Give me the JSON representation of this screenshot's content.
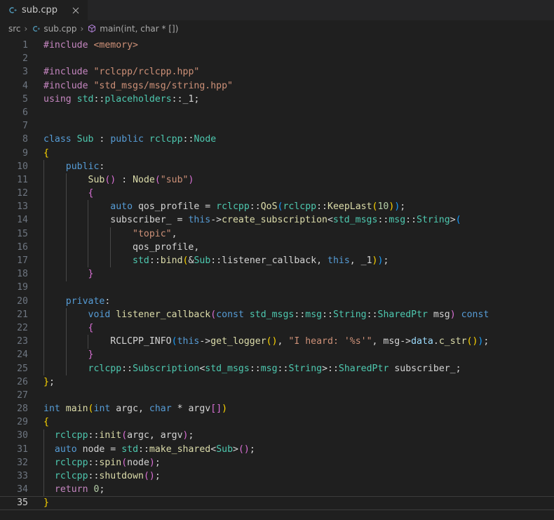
{
  "window": {
    "background": "#1f1f1f",
    "tabbar_background": "#252526"
  },
  "tab_bar": {
    "tabs": [
      {
        "label": "sub.cpp",
        "icon": "cpp-file-icon",
        "icon_color": "#519aba",
        "active": true,
        "close_icon": "close-icon"
      }
    ]
  },
  "breadcrumb": {
    "items": [
      {
        "label": "src",
        "icon": null
      },
      {
        "label": "sub.cpp",
        "icon": "cpp-file-icon"
      },
      {
        "label": "main(int, char * [])",
        "icon": "symbol-method-icon"
      }
    ],
    "separator": "›"
  },
  "editor": {
    "language": "cpp",
    "active_line": 35,
    "total_lines": 35,
    "line_numbers": [
      1,
      2,
      3,
      4,
      5,
      6,
      7,
      8,
      9,
      10,
      11,
      12,
      13,
      14,
      15,
      16,
      17,
      18,
      19,
      20,
      21,
      22,
      23,
      24,
      25,
      26,
      27,
      28,
      29,
      30,
      31,
      32,
      33,
      34,
      35
    ],
    "lines": [
      {
        "n": 1,
        "indent": 0,
        "tokens": [
          {
            "t": "#include ",
            "c": "t-pre"
          },
          {
            "t": "<memory>",
            "c": "t-str"
          }
        ]
      },
      {
        "n": 2,
        "indent": 0,
        "tokens": []
      },
      {
        "n": 3,
        "indent": 0,
        "tokens": [
          {
            "t": "#include ",
            "c": "t-pre"
          },
          {
            "t": "\"rclcpp/rclcpp.hpp\"",
            "c": "t-str"
          }
        ]
      },
      {
        "n": 4,
        "indent": 0,
        "tokens": [
          {
            "t": "#include ",
            "c": "t-pre"
          },
          {
            "t": "\"std_msgs/msg/string.hpp\"",
            "c": "t-str"
          }
        ]
      },
      {
        "n": 5,
        "indent": 0,
        "tokens": [
          {
            "t": "using",
            "c": "t-pre"
          },
          {
            "t": " ",
            "c": "t-plain"
          },
          {
            "t": "std",
            "c": "t-type"
          },
          {
            "t": "::",
            "c": "t-plain"
          },
          {
            "t": "placeholders",
            "c": "t-type"
          },
          {
            "t": "::",
            "c": "t-plain"
          },
          {
            "t": "_1",
            "c": "t-plain"
          },
          {
            "t": ";",
            "c": "t-plain"
          }
        ]
      },
      {
        "n": 6,
        "indent": 0,
        "tokens": []
      },
      {
        "n": 7,
        "indent": 0,
        "tokens": []
      },
      {
        "n": 8,
        "indent": 0,
        "tokens": [
          {
            "t": "class",
            "c": "t-key"
          },
          {
            "t": " ",
            "c": "t-plain"
          },
          {
            "t": "Sub",
            "c": "t-type"
          },
          {
            "t": " : ",
            "c": "t-plain"
          },
          {
            "t": "public",
            "c": "t-key"
          },
          {
            "t": " ",
            "c": "t-plain"
          },
          {
            "t": "rclcpp",
            "c": "t-type"
          },
          {
            "t": "::",
            "c": "t-plain"
          },
          {
            "t": "Node",
            "c": "t-type"
          }
        ]
      },
      {
        "n": 9,
        "indent": 0,
        "tokens": [
          {
            "t": "{",
            "c": "t-b1"
          }
        ]
      },
      {
        "n": 10,
        "indent": 1,
        "tokens": [
          {
            "t": "    ",
            "c": "t-plain"
          },
          {
            "t": "public",
            "c": "t-key"
          },
          {
            "t": ":",
            "c": "t-plain"
          }
        ]
      },
      {
        "n": 11,
        "indent": 2,
        "tokens": [
          {
            "t": "        ",
            "c": "t-plain"
          },
          {
            "t": "Sub",
            "c": "t-fn"
          },
          {
            "t": "()",
            "c": "t-b2"
          },
          {
            "t": " : ",
            "c": "t-plain"
          },
          {
            "t": "Node",
            "c": "t-fn"
          },
          {
            "t": "(",
            "c": "t-b2"
          },
          {
            "t": "\"sub\"",
            "c": "t-str"
          },
          {
            "t": ")",
            "c": "t-b2"
          }
        ]
      },
      {
        "n": 12,
        "indent": 2,
        "tokens": [
          {
            "t": "        ",
            "c": "t-plain"
          },
          {
            "t": "{",
            "c": "t-b2"
          }
        ]
      },
      {
        "n": 13,
        "indent": 3,
        "tokens": [
          {
            "t": "            ",
            "c": "t-plain"
          },
          {
            "t": "auto",
            "c": "t-key"
          },
          {
            "t": " qos_profile ",
            "c": "t-plain"
          },
          {
            "t": "= ",
            "c": "t-plain"
          },
          {
            "t": "rclcpp",
            "c": "t-type"
          },
          {
            "t": "::",
            "c": "t-plain"
          },
          {
            "t": "QoS",
            "c": "t-fn"
          },
          {
            "t": "(",
            "c": "t-b3"
          },
          {
            "t": "rclcpp",
            "c": "t-type"
          },
          {
            "t": "::",
            "c": "t-plain"
          },
          {
            "t": "KeepLast",
            "c": "t-fn"
          },
          {
            "t": "(",
            "c": "t-b1"
          },
          {
            "t": "10",
            "c": "t-num"
          },
          {
            "t": ")",
            "c": "t-b1"
          },
          {
            "t": ")",
            "c": "t-b3"
          },
          {
            "t": ";",
            "c": "t-plain"
          }
        ]
      },
      {
        "n": 14,
        "indent": 3,
        "tokens": [
          {
            "t": "            subscriber_ = ",
            "c": "t-plain"
          },
          {
            "t": "this",
            "c": "t-key"
          },
          {
            "t": "->",
            "c": "t-plain"
          },
          {
            "t": "create_subscription",
            "c": "t-fn"
          },
          {
            "t": "<",
            "c": "t-plain"
          },
          {
            "t": "std_msgs",
            "c": "t-type"
          },
          {
            "t": "::",
            "c": "t-plain"
          },
          {
            "t": "msg",
            "c": "t-type"
          },
          {
            "t": "::",
            "c": "t-plain"
          },
          {
            "t": "String",
            "c": "t-type"
          },
          {
            "t": ">",
            "c": "t-plain"
          },
          {
            "t": "(",
            "c": "t-b3"
          }
        ]
      },
      {
        "n": 15,
        "indent": 4,
        "tokens": [
          {
            "t": "                ",
            "c": "t-plain"
          },
          {
            "t": "\"topic\"",
            "c": "t-str"
          },
          {
            "t": ",",
            "c": "t-plain"
          }
        ]
      },
      {
        "n": 16,
        "indent": 4,
        "tokens": [
          {
            "t": "                qos_profile,",
            "c": "t-plain"
          }
        ]
      },
      {
        "n": 17,
        "indent": 4,
        "tokens": [
          {
            "t": "                ",
            "c": "t-plain"
          },
          {
            "t": "std",
            "c": "t-type"
          },
          {
            "t": "::",
            "c": "t-plain"
          },
          {
            "t": "bind",
            "c": "t-fn"
          },
          {
            "t": "(",
            "c": "t-b1"
          },
          {
            "t": "&",
            "c": "t-plain"
          },
          {
            "t": "Sub",
            "c": "t-type"
          },
          {
            "t": "::",
            "c": "t-plain"
          },
          {
            "t": "listener_callback, ",
            "c": "t-plain"
          },
          {
            "t": "this",
            "c": "t-key"
          },
          {
            "t": ", _1",
            "c": "t-plain"
          },
          {
            "t": ")",
            "c": "t-b1"
          },
          {
            "t": ")",
            "c": "t-b3"
          },
          {
            "t": ";",
            "c": "t-plain"
          }
        ]
      },
      {
        "n": 18,
        "indent": 2,
        "tokens": [
          {
            "t": "        ",
            "c": "t-plain"
          },
          {
            "t": "}",
            "c": "t-b2"
          }
        ]
      },
      {
        "n": 19,
        "indent": 0,
        "tokens": []
      },
      {
        "n": 20,
        "indent": 1,
        "tokens": [
          {
            "t": "    ",
            "c": "t-plain"
          },
          {
            "t": "private",
            "c": "t-key"
          },
          {
            "t": ":",
            "c": "t-plain"
          }
        ]
      },
      {
        "n": 21,
        "indent": 2,
        "tokens": [
          {
            "t": "        ",
            "c": "t-plain"
          },
          {
            "t": "void",
            "c": "t-key"
          },
          {
            "t": " ",
            "c": "t-plain"
          },
          {
            "t": "listener_callback",
            "c": "t-fn"
          },
          {
            "t": "(",
            "c": "t-b2"
          },
          {
            "t": "const",
            "c": "t-key"
          },
          {
            "t": " ",
            "c": "t-plain"
          },
          {
            "t": "std_msgs",
            "c": "t-type"
          },
          {
            "t": "::",
            "c": "t-plain"
          },
          {
            "t": "msg",
            "c": "t-type"
          },
          {
            "t": "::",
            "c": "t-plain"
          },
          {
            "t": "String",
            "c": "t-type"
          },
          {
            "t": "::",
            "c": "t-plain"
          },
          {
            "t": "SharedPtr",
            "c": "t-type"
          },
          {
            "t": " msg",
            "c": "t-plain"
          },
          {
            "t": ")",
            "c": "t-b2"
          },
          {
            "t": " ",
            "c": "t-plain"
          },
          {
            "t": "const",
            "c": "t-key"
          }
        ]
      },
      {
        "n": 22,
        "indent": 2,
        "tokens": [
          {
            "t": "        ",
            "c": "t-plain"
          },
          {
            "t": "{",
            "c": "t-b2"
          }
        ]
      },
      {
        "n": 23,
        "indent": 3,
        "tokens": [
          {
            "t": "            RCLCPP_INFO",
            "c": "t-plain"
          },
          {
            "t": "(",
            "c": "t-b3"
          },
          {
            "t": "this",
            "c": "t-key"
          },
          {
            "t": "->",
            "c": "t-plain"
          },
          {
            "t": "get_logger",
            "c": "t-fn"
          },
          {
            "t": "()",
            "c": "t-b1"
          },
          {
            "t": ", ",
            "c": "t-plain"
          },
          {
            "t": "\"I heard: '%s'\"",
            "c": "t-str"
          },
          {
            "t": ", msg",
            "c": "t-plain"
          },
          {
            "t": "->",
            "c": "t-plain"
          },
          {
            "t": "data",
            "c": "t-var"
          },
          {
            "t": ".",
            "c": "t-plain"
          },
          {
            "t": "c_str",
            "c": "t-fn"
          },
          {
            "t": "()",
            "c": "t-b1"
          },
          {
            "t": ")",
            "c": "t-b3"
          },
          {
            "t": ";",
            "c": "t-plain"
          }
        ]
      },
      {
        "n": 24,
        "indent": 2,
        "tokens": [
          {
            "t": "        ",
            "c": "t-plain"
          },
          {
            "t": "}",
            "c": "t-b2"
          }
        ]
      },
      {
        "n": 25,
        "indent": 2,
        "tokens": [
          {
            "t": "        ",
            "c": "t-plain"
          },
          {
            "t": "rclcpp",
            "c": "t-type"
          },
          {
            "t": "::",
            "c": "t-plain"
          },
          {
            "t": "Subscription",
            "c": "t-type"
          },
          {
            "t": "<",
            "c": "t-plain"
          },
          {
            "t": "std_msgs",
            "c": "t-type"
          },
          {
            "t": "::",
            "c": "t-plain"
          },
          {
            "t": "msg",
            "c": "t-type"
          },
          {
            "t": "::",
            "c": "t-plain"
          },
          {
            "t": "String",
            "c": "t-type"
          },
          {
            "t": ">",
            "c": "t-plain"
          },
          {
            "t": "::",
            "c": "t-plain"
          },
          {
            "t": "SharedPtr",
            "c": "t-type"
          },
          {
            "t": " subscriber_;",
            "c": "t-plain"
          }
        ]
      },
      {
        "n": 26,
        "indent": 0,
        "tokens": [
          {
            "t": "}",
            "c": "t-b1"
          },
          {
            "t": ";",
            "c": "t-plain"
          }
        ]
      },
      {
        "n": 27,
        "indent": 0,
        "tokens": []
      },
      {
        "n": 28,
        "indent": 0,
        "tokens": [
          {
            "t": "int",
            "c": "t-key"
          },
          {
            "t": " ",
            "c": "t-plain"
          },
          {
            "t": "main",
            "c": "t-fn"
          },
          {
            "t": "(",
            "c": "t-b1"
          },
          {
            "t": "int",
            "c": "t-key"
          },
          {
            "t": " argc, ",
            "c": "t-plain"
          },
          {
            "t": "char",
            "c": "t-key"
          },
          {
            "t": " * argv",
            "c": "t-plain"
          },
          {
            "t": "[]",
            "c": "t-b2"
          },
          {
            "t": ")",
            "c": "t-b1"
          }
        ]
      },
      {
        "n": 29,
        "indent": 0,
        "tokens": [
          {
            "t": "{",
            "c": "t-b1"
          }
        ]
      },
      {
        "n": 30,
        "indent": 1,
        "tokens": [
          {
            "t": "  ",
            "c": "t-plain"
          },
          {
            "t": "rclcpp",
            "c": "t-type"
          },
          {
            "t": "::",
            "c": "t-plain"
          },
          {
            "t": "init",
            "c": "t-fn"
          },
          {
            "t": "(",
            "c": "t-b2"
          },
          {
            "t": "argc, argv",
            "c": "t-plain"
          },
          {
            "t": ")",
            "c": "t-b2"
          },
          {
            "t": ";",
            "c": "t-plain"
          }
        ]
      },
      {
        "n": 31,
        "indent": 1,
        "tokens": [
          {
            "t": "  ",
            "c": "t-plain"
          },
          {
            "t": "auto",
            "c": "t-key"
          },
          {
            "t": " node = ",
            "c": "t-plain"
          },
          {
            "t": "std",
            "c": "t-type"
          },
          {
            "t": "::",
            "c": "t-plain"
          },
          {
            "t": "make_shared",
            "c": "t-fn"
          },
          {
            "t": "<",
            "c": "t-plain"
          },
          {
            "t": "Sub",
            "c": "t-type"
          },
          {
            "t": ">",
            "c": "t-plain"
          },
          {
            "t": "()",
            "c": "t-b2"
          },
          {
            "t": ";",
            "c": "t-plain"
          }
        ]
      },
      {
        "n": 32,
        "indent": 1,
        "tokens": [
          {
            "t": "  ",
            "c": "t-plain"
          },
          {
            "t": "rclcpp",
            "c": "t-type"
          },
          {
            "t": "::",
            "c": "t-plain"
          },
          {
            "t": "spin",
            "c": "t-fn"
          },
          {
            "t": "(",
            "c": "t-b2"
          },
          {
            "t": "node",
            "c": "t-plain"
          },
          {
            "t": ")",
            "c": "t-b2"
          },
          {
            "t": ";",
            "c": "t-plain"
          }
        ]
      },
      {
        "n": 33,
        "indent": 1,
        "tokens": [
          {
            "t": "  ",
            "c": "t-plain"
          },
          {
            "t": "rclcpp",
            "c": "t-type"
          },
          {
            "t": "::",
            "c": "t-plain"
          },
          {
            "t": "shutdown",
            "c": "t-fn"
          },
          {
            "t": "()",
            "c": "t-b2"
          },
          {
            "t": ";",
            "c": "t-plain"
          }
        ]
      },
      {
        "n": 34,
        "indent": 1,
        "tokens": [
          {
            "t": "  ",
            "c": "t-plain"
          },
          {
            "t": "return",
            "c": "t-pre"
          },
          {
            "t": " ",
            "c": "t-plain"
          },
          {
            "t": "0",
            "c": "t-num"
          },
          {
            "t": ";",
            "c": "t-plain"
          }
        ]
      },
      {
        "n": 35,
        "indent": 0,
        "tokens": [
          {
            "t": "}",
            "c": "t-b1"
          }
        ]
      }
    ],
    "indent_guides": [
      {
        "line_from": 10,
        "line_to": 25,
        "level": 1
      },
      {
        "line_from": 11,
        "line_to": 18,
        "level": 2
      },
      {
        "line_from": 13,
        "line_to": 17,
        "level": 3
      },
      {
        "line_from": 15,
        "line_to": 17,
        "level": 4
      },
      {
        "line_from": 21,
        "line_to": 25,
        "level": 2
      },
      {
        "line_from": 23,
        "line_to": 23,
        "level": 3
      },
      {
        "line_from": 30,
        "line_to": 34,
        "level": 1
      }
    ],
    "colors": {
      "background": "#1f1f1f",
      "foreground": "#d4d4d4",
      "line_number": "#6e7681",
      "active_line_number": "#cfcfcf",
      "indent_guide": "#474747",
      "active_line_border": "#3c3c3c",
      "keyword": "#569cd6",
      "preprocessor": "#c586c0",
      "string": "#ce9178",
      "type": "#4ec9b0",
      "function": "#dcdcaa",
      "variable": "#9cdcfe",
      "number": "#b5cea8"
    }
  }
}
